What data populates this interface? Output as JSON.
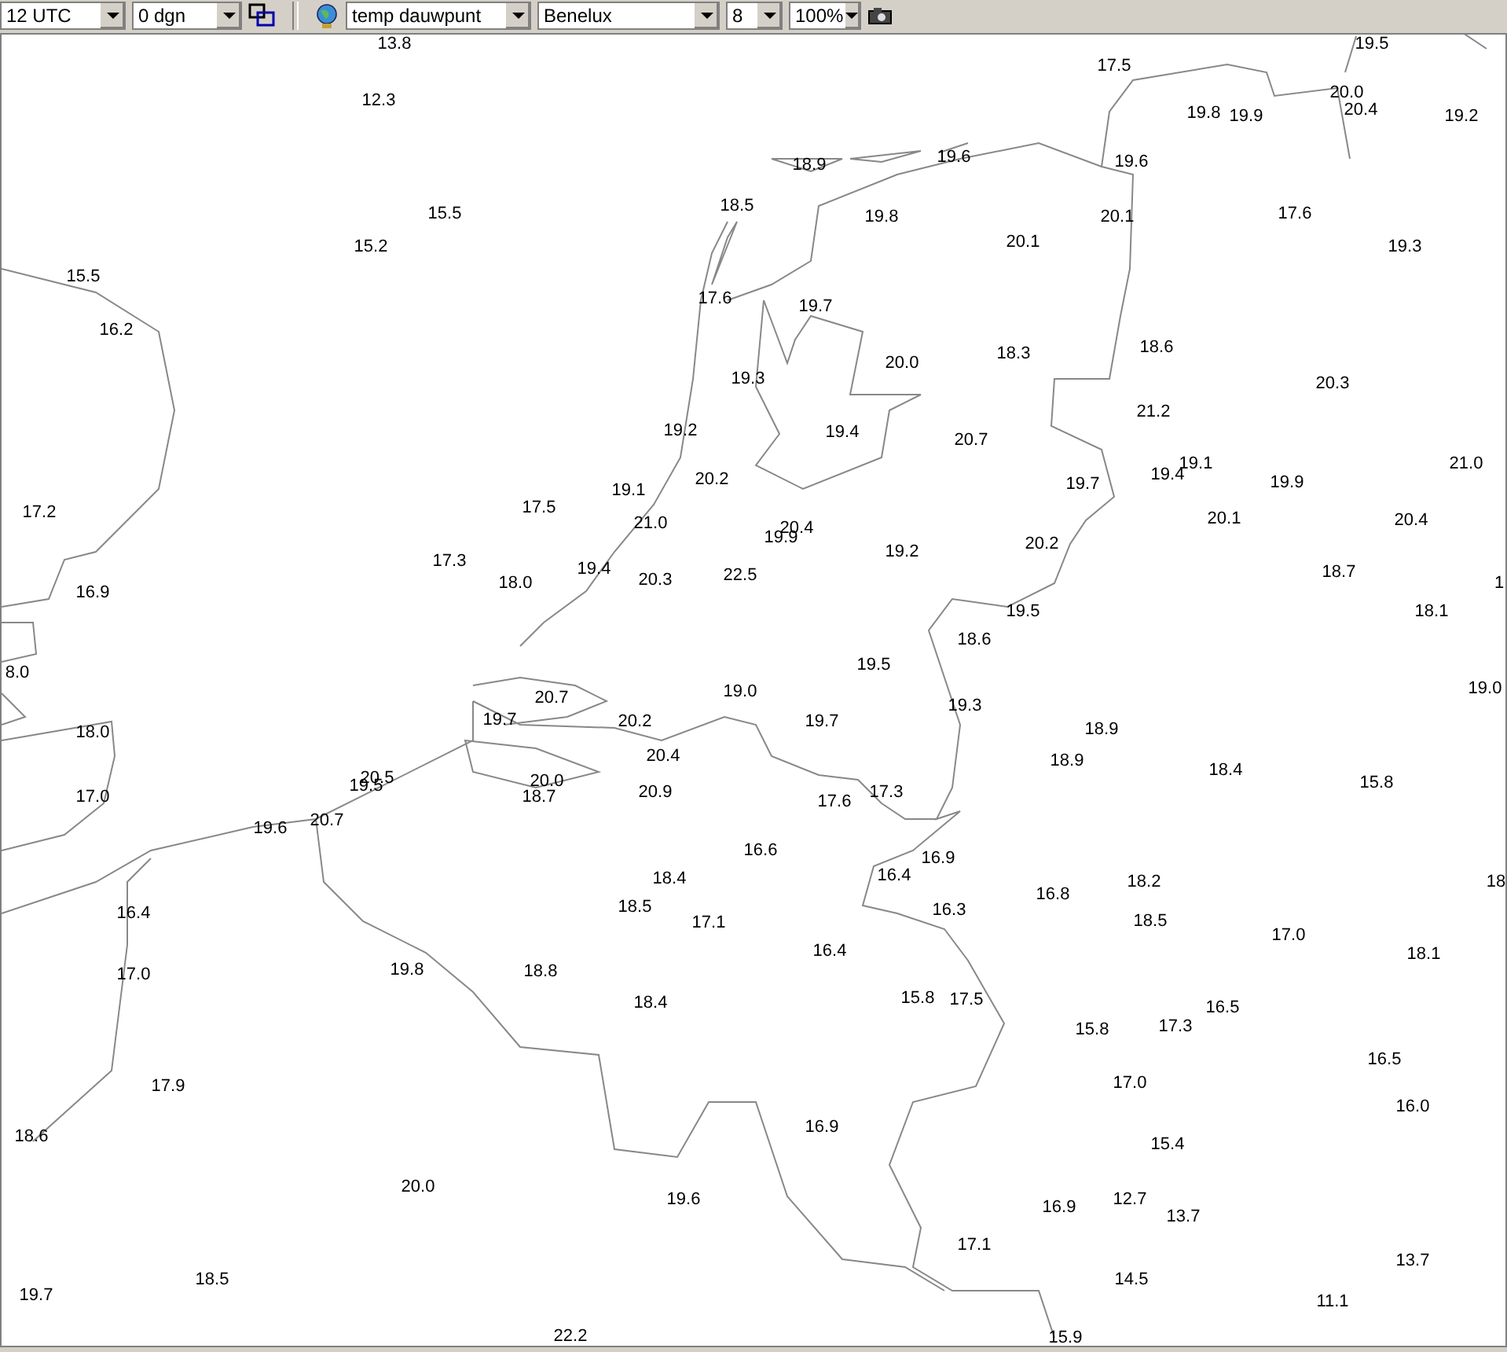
{
  "toolbar": {
    "left_dropdowns": [
      {
        "value": "12 UTC"
      },
      {
        "value": "0 dgn"
      }
    ],
    "right_dropdowns": [
      {
        "value": "temp dauwpunt"
      },
      {
        "value": "Benelux"
      },
      {
        "value": "8"
      },
      {
        "value": "100%"
      }
    ]
  },
  "map": {
    "readings": [
      "13.8",
      "19.5",
      "17.5",
      "12.3",
      "20.0",
      "19.8",
      "19.9",
      "20.4",
      "19.2",
      "18.9",
      "19.6",
      "19.6",
      "15.5",
      "18.5",
      "19.8",
      "20.1",
      "17.6",
      "15.2",
      "20.1",
      "19.3",
      "15.5",
      "17.6",
      "19.7",
      "16.2",
      "19.3",
      "20.0",
      "18.3",
      "18.6",
      "20.3",
      "21.2",
      "19.2",
      "19.4",
      "20.7",
      "19.1",
      "21.0",
      "19.1",
      "20.2",
      "19.7",
      "19.4",
      "19.9",
      "17.2",
      "17.5",
      "21.0",
      "20.4",
      "19.9",
      "20.1",
      "20.4",
      "17.3",
      "19.2",
      "20.2",
      "16.9",
      "18.0",
      "19.4",
      "20.3",
      "22.5",
      "18.7",
      "1",
      "19.5",
      "18.1",
      "18.6",
      "8.0",
      "19.5",
      "20.7",
      "19.0",
      "19.3",
      "19.0",
      "18.0",
      "19.7",
      "20.2",
      "19.7",
      "18.9",
      "20.4",
      "18.9",
      "17.0",
      "20.5",
      "19.5",
      "20.0",
      "18.7",
      "20.9",
      "17.6",
      "17.3",
      "18.4",
      "15.8",
      "19.6",
      "20.7",
      "16.6",
      "16.9",
      "18.4",
      "16.4",
      "16.8",
      "18.2",
      "18",
      "16.4",
      "18.5",
      "17.1",
      "16.3",
      "18.5",
      "17.0",
      "16.4",
      "18.1",
      "17.0",
      "19.8",
      "18.8",
      "18.4",
      "15.8",
      "17.5",
      "16.5",
      "15.8",
      "17.3",
      "16.5",
      "17.9",
      "17.0",
      "16.0",
      "18.6",
      "16.9",
      "15.4",
      "20.0",
      "19.6",
      "16.9",
      "12.7",
      "13.7",
      "17.1",
      "13.7",
      "18.5",
      "14.5",
      "19.7",
      "11.1",
      "22.2",
      "15.9"
    ]
  }
}
